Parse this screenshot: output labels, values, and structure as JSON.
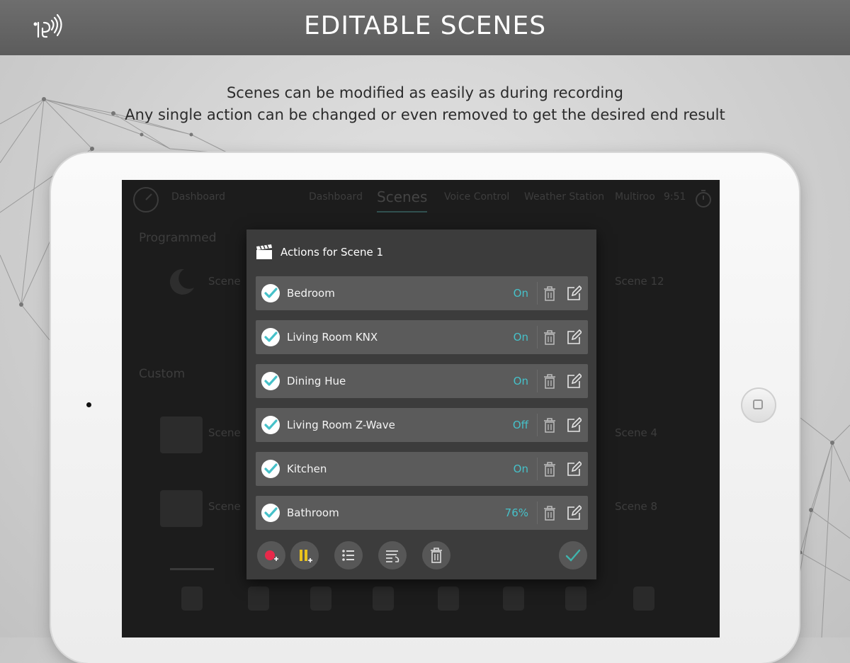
{
  "header": {
    "title": "EDITABLE SCENES",
    "logo_icon": "remote-signal-icon"
  },
  "caption": {
    "line1": "Scenes can be modified as easily as during recording",
    "line2": "Any single action can be changed or even removed to get the desired end result"
  },
  "background_app": {
    "nav": [
      "Dashboard",
      "Dashboard",
      "Scenes",
      "Voice Control",
      "Weather Station",
      "Multiroo",
      "9:51"
    ],
    "sections": [
      "Programmed",
      "Custom"
    ],
    "scene_labels": [
      "Scene",
      "Scene 12",
      "Scene",
      "Scene 4",
      "Scene",
      "Scene 8"
    ]
  },
  "dialog": {
    "title": "Actions for Scene 1",
    "actions": [
      {
        "name": "Bedroom",
        "value": "On",
        "checked": true
      },
      {
        "name": "Living Room KNX",
        "value": "On",
        "checked": true
      },
      {
        "name": "Dining Hue",
        "value": "On",
        "checked": true
      },
      {
        "name": "Living Room Z-Wave",
        "value": "Off",
        "checked": true
      },
      {
        "name": "Kitchen",
        "value": "On",
        "checked": true
      },
      {
        "name": "Bathroom",
        "value": "76%",
        "checked": true
      }
    ],
    "toolbar": [
      "record-add-icon",
      "pause-add-icon",
      "list-icon",
      "reorder-icon",
      "trash-icon"
    ],
    "confirm_icon": "checkmark-icon"
  },
  "colors": {
    "accent": "#46c1c9",
    "record": "#e8294a",
    "pause": "#e9c21e",
    "confirm": "#3fb4ad"
  }
}
